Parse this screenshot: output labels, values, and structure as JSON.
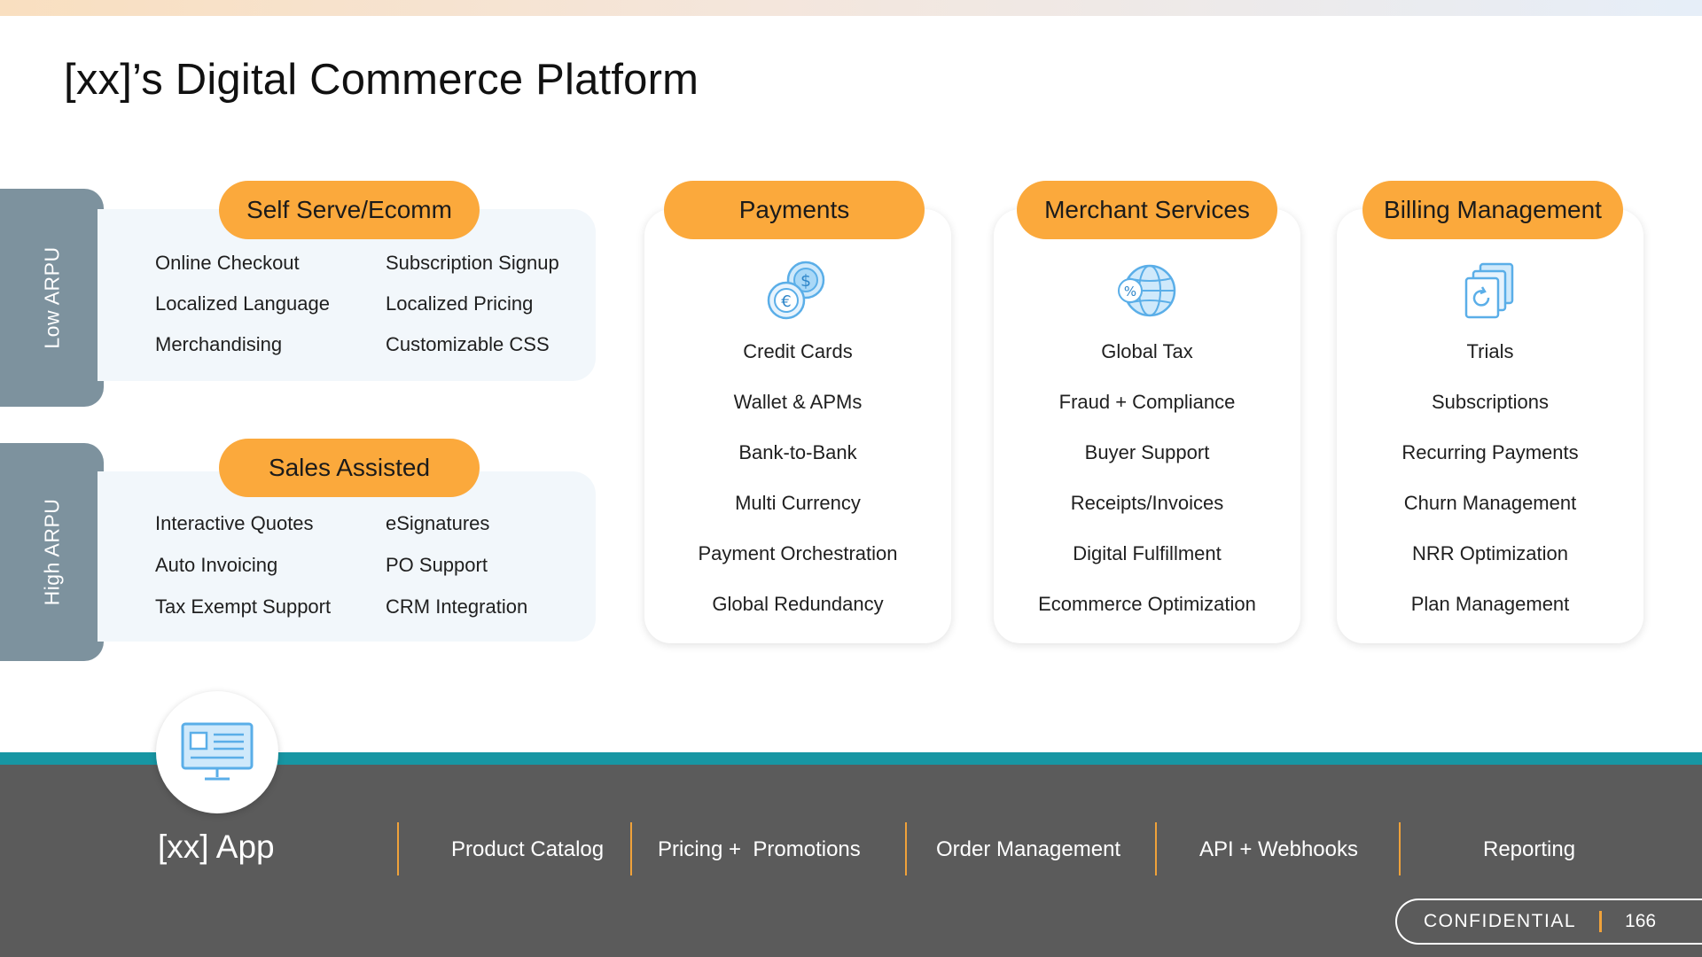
{
  "slide": {
    "title": "[xx]’s Digital Commerce Platform"
  },
  "arpu": {
    "low": "Low ARPU",
    "high": "High ARPU"
  },
  "self_serve": {
    "label": "Self Serve/Ecomm",
    "features": [
      "Online Checkout",
      "Subscription Signup",
      "Localized Language",
      "Localized Pricing",
      "Merchandising",
      "Customizable CSS"
    ]
  },
  "sales_assisted": {
    "label": "Sales Assisted",
    "features": [
      "Interactive Quotes",
      "eSignatures",
      "Auto Invoicing",
      "PO Support",
      "Tax Exempt Support",
      "CRM Integration"
    ]
  },
  "payments": {
    "label": "Payments",
    "icon": "currency-coins-icon",
    "items": [
      "Credit Cards",
      "Wallet & APMs",
      "Bank-to-Bank",
      "Multi Currency",
      "Payment Orchestration",
      "Global Redundancy"
    ]
  },
  "merchant_services": {
    "label": "Merchant Services",
    "icon": "globe-percent-icon",
    "items": [
      "Global Tax",
      "Fraud + Compliance",
      "Buyer Support",
      "Receipts/Invoices",
      "Digital Fulfillment",
      "Ecommerce Optimization"
    ]
  },
  "billing_management": {
    "label": "Billing Management",
    "icon": "recurring-docs-icon",
    "items": [
      "Trials",
      "Subscriptions",
      "Recurring Payments",
      "Churn Management",
      "NRR Optimization",
      "Plan Management"
    ]
  },
  "app": {
    "name": "[xx] App",
    "icon": "monitor-icon",
    "modules": [
      "Product Catalog",
      "Pricing +  Promotions",
      "Order Management",
      "API + Webhooks",
      "Reporting"
    ]
  },
  "footer": {
    "confidential": "CONFIDENTIAL",
    "page_number": "166"
  },
  "colors": {
    "accent_orange": "#fba93c",
    "teal_band": "#1796a3",
    "dark_band": "#5b5b5b",
    "arpu_tab": "#7d929e",
    "icon_blue": "#5aaee8"
  }
}
